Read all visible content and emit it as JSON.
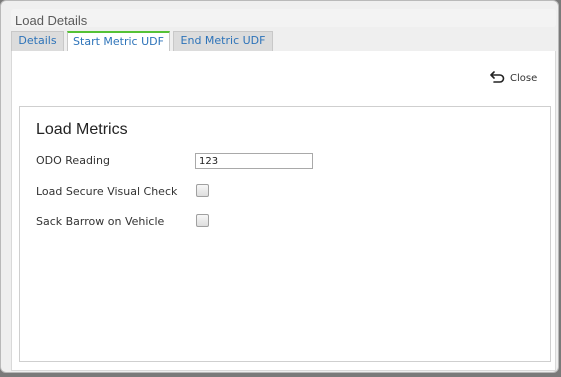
{
  "dialog": {
    "title": "Load Details"
  },
  "tabs": [
    {
      "label": "Details",
      "active": false
    },
    {
      "label": "Start Metric UDF",
      "active": true
    },
    {
      "label": "End Metric UDF",
      "active": false
    }
  ],
  "toolbar": {
    "close_label": "Close",
    "close_icon": "undo-arrow-icon"
  },
  "metrics": {
    "heading": "Load Metrics",
    "fields": [
      {
        "label": "ODO Reading",
        "type": "text",
        "value": "123"
      },
      {
        "label": "Load Secure Visual Check",
        "type": "checkbox",
        "checked": false
      },
      {
        "label": "Sack Barrow on Vehicle",
        "type": "checkbox",
        "checked": false
      }
    ]
  },
  "colors": {
    "tab_text": "#2d73b9",
    "active_tab_accent": "#55c236"
  }
}
